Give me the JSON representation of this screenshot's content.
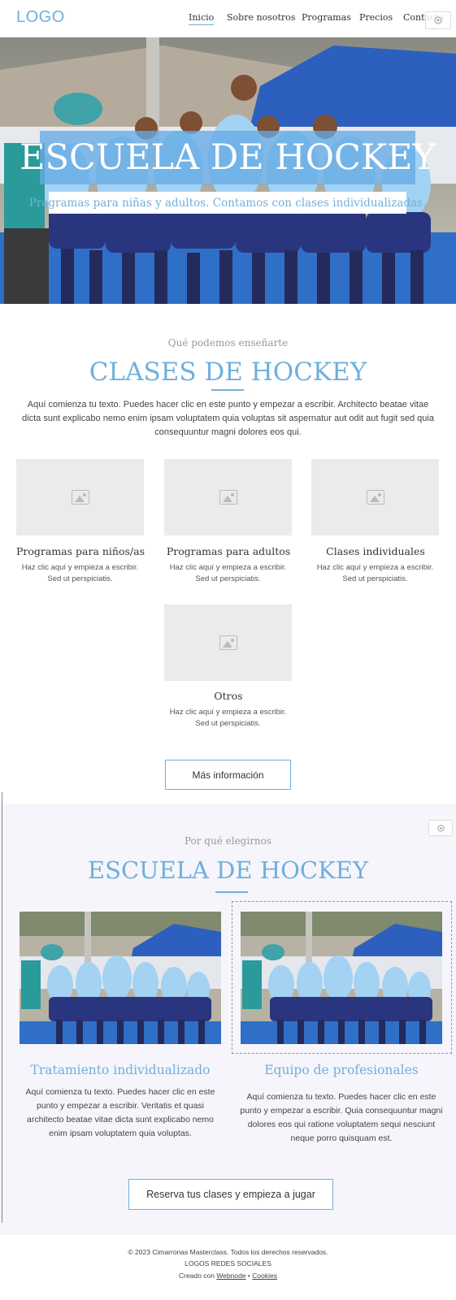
{
  "header": {
    "logo": "LOGO",
    "nav": [
      "Inicio",
      "Sobre nosotros",
      "Programas",
      "Precios",
      "Contacto"
    ],
    "active_nav": "Inicio",
    "settings_icon": "gear-icon"
  },
  "hero": {
    "title": "ESCUELA DE HOCKEY",
    "subtitle": "Programas para niñas y adultos. Contamos con clases individualizadas."
  },
  "classes": {
    "eyebrow": "Qué podemos enseñarte",
    "title": "CLASES DE HOCKEY",
    "text": "Aquí comienza tu texto. Puedes hacer clic en este punto y empezar a escribir. Architecto beatae vitae dicta sunt explicabo nemo enim ipsam voluptatem quia voluptas sit aspernatur aut odit aut fugit sed quia consequuntur magni dolores eos qui.",
    "cards": [
      {
        "title": "Programas para niños/as",
        "text": "Haz clic aquí y empieza a escribir. Sed ut perspiciatis."
      },
      {
        "title": "Programas para adultos",
        "text": "Haz clic aquí y empieza a escribir. Sed ut perspiciatis."
      },
      {
        "title": "Clases individuales",
        "text": "Haz clic aquí y empieza a escribir. Sed ut perspiciatis."
      },
      {
        "title": "Otros",
        "text": "Haz clic aquí y empieza a escribir. Sed ut perspiciatis."
      }
    ],
    "button": "Más información"
  },
  "why": {
    "eyebrow": "Por qué elegirnos",
    "title": "ESCUELA DE HOCKEY",
    "features": [
      {
        "title": "Tratamiento individualizado",
        "text": "Aquí comienza tu texto. Puedes hacer clic en este punto y empezar a escribir. Veritatis et quasi architecto beatae vitae dicta sunt explicabo nemo enim ipsam voluptatem quia voluptas."
      },
      {
        "title": "Equipo de profesionales",
        "text": "Aquí comienza tu texto. Puedes hacer clic en este punto y empezar a escribir. Quia consequuntur magni dolores eos qui ratione voluptatem sequi nesciunt neque porro quisquam est."
      }
    ],
    "button": "Reserva tus clases y empieza a jugar"
  },
  "footer": {
    "copyright": "© 2023 Cimarronas Masterclass. Todos los derechos reservados.",
    "social": "LOGOS REDES SOCIALES",
    "created_prefix": "Creado con",
    "created_link": "Webnode",
    "separator": "•",
    "cookies": "Cookies"
  },
  "colors": {
    "accent": "#6fb0de",
    "section_bg": "#f6f5fb",
    "jersey": "#9fd0f0",
    "skirt": "#2a3580"
  }
}
